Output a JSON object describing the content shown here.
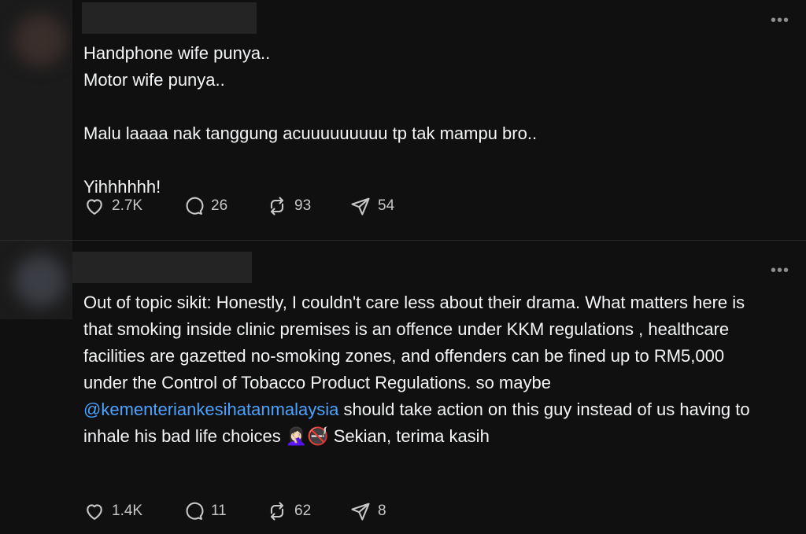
{
  "posts": [
    {
      "more_label": "•••",
      "body": {
        "lines": [
          "Handphone wife punya..",
          "Motor wife punya..",
          "",
          "Malu laaaa nak tanggung acuuuuuuuuu tp tak mampu bro..",
          "",
          "Yihhhhhh!"
        ]
      },
      "stats": {
        "likes": "2.7K",
        "comments": "26",
        "reposts": "93",
        "shares": "54"
      }
    },
    {
      "more_label": "•••",
      "body": {
        "before": "Out of topic sikit: Honestly, I couldn't care less about their drama. What matters here is that smoking inside clinic premises is an offence under KKM regulations , healthcare facilities are gazetted no-smoking zones, and offenders can be fined up to RM5,000 under the Control of Tobacco Product Regulations. so maybe ",
        "mention": "@kementeriankesihatanmalaysia",
        "after": " should take action on this guy instead of us having to inhale his bad life choices 🤦🏻‍♀️🚭 Sekian, terima kasih"
      },
      "stats": {
        "likes": "1.4K",
        "comments": "11",
        "reposts": "62",
        "shares": "8"
      }
    }
  ],
  "icons": {
    "like": "heart-icon",
    "comment": "comment-bubble-icon",
    "repost": "repost-icon",
    "share": "send-icon"
  },
  "colors": {
    "background": "#101010",
    "text": "#f3f5f7",
    "mention": "#4aa3ff",
    "muted": "#c8c8c8"
  }
}
